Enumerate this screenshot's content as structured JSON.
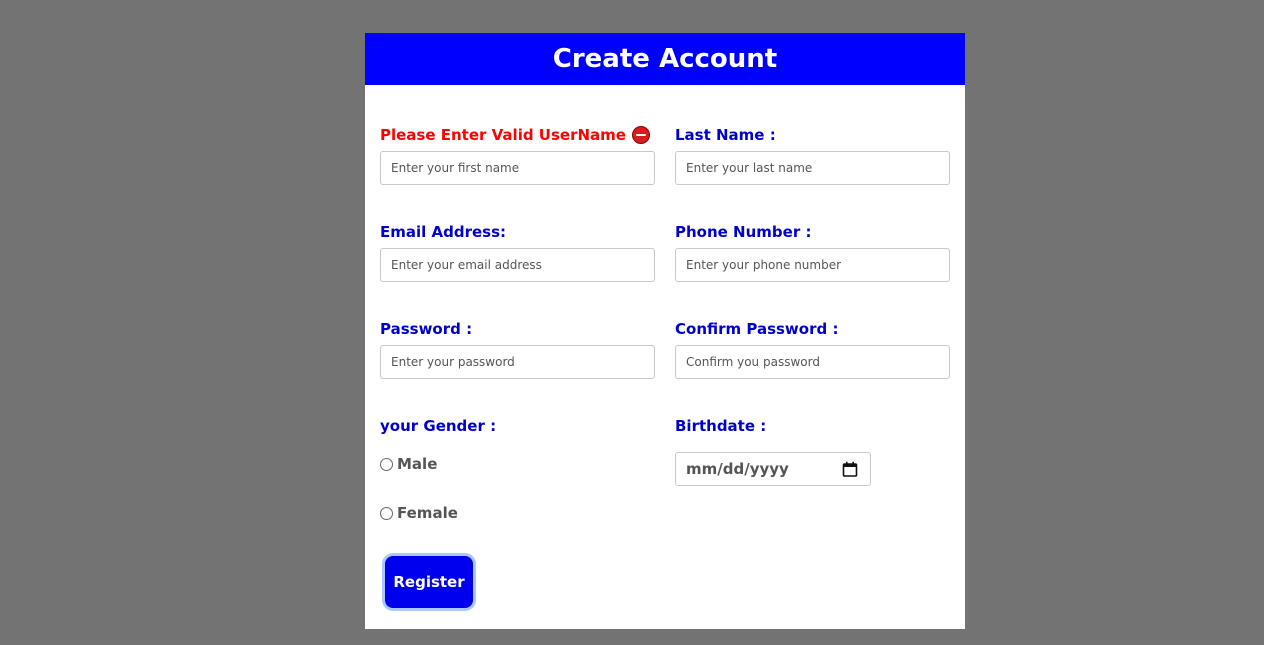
{
  "form": {
    "title": "Create Account",
    "first_name": {
      "label": "Please Enter Valid UserName",
      "placeholder": "Enter your first name",
      "error": true
    },
    "last_name": {
      "label": "Last Name :",
      "placeholder": "Enter your last name"
    },
    "email": {
      "label": "Email Address:",
      "placeholder": "Enter your email address"
    },
    "phone": {
      "label": "Phone Number :",
      "placeholder": "Enter your phone number"
    },
    "password": {
      "label": "Password :",
      "placeholder": "Enter your password"
    },
    "confirm_password": {
      "label": "Confirm Password :",
      "placeholder": "Confirm you password"
    },
    "gender": {
      "label": "your Gender :",
      "options": [
        "Male",
        "Female"
      ]
    },
    "birthdate": {
      "label": "Birthdate :",
      "placeholder": "mm/dd/yyyy"
    },
    "register_label": "Register"
  },
  "colors": {
    "background": "#737373",
    "header": "#0000ff",
    "label": "#0000cd",
    "error": "#ff0000",
    "button": "#0000ee"
  }
}
